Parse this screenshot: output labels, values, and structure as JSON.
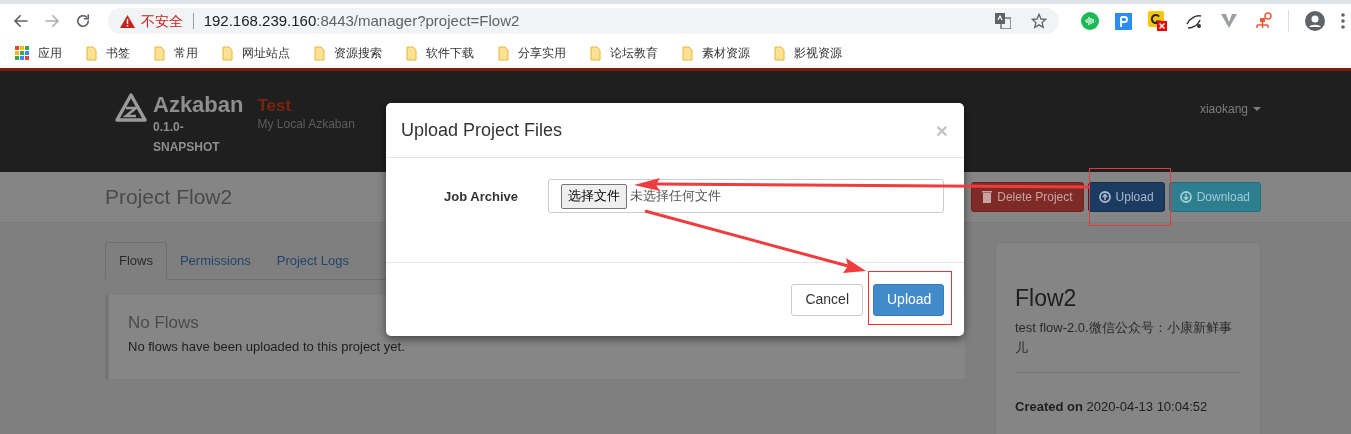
{
  "browser": {
    "nav_buttons": [
      {
        "kind": "back",
        "disabled": false
      },
      {
        "kind": "forward",
        "disabled": true
      },
      {
        "kind": "reload",
        "disabled": false
      }
    ],
    "security_label": "不安全",
    "url_host": "192.168.239.160",
    "url_rest": ":8443/manager?project=Flow2",
    "bookmarks": [
      {
        "label": "应用",
        "kind": "apps"
      },
      {
        "label": "书签",
        "kind": "folder"
      },
      {
        "label": "常用",
        "kind": "folder"
      },
      {
        "label": "网址站点",
        "kind": "folder"
      },
      {
        "label": "资源搜索",
        "kind": "folder"
      },
      {
        "label": "软件下载",
        "kind": "folder"
      },
      {
        "label": "分享实用",
        "kind": "folder"
      },
      {
        "label": "论坛教育",
        "kind": "folder"
      },
      {
        "label": "素材资源",
        "kind": "folder"
      },
      {
        "label": "影视资源",
        "kind": "folder"
      }
    ]
  },
  "navbar": {
    "brand": "Azkaban",
    "version": "0.1.0-SNAPSHOT",
    "env_name": "Test",
    "env_description": "My Local Azkaban",
    "user": "xiaokang"
  },
  "project": {
    "title": "Project Flow2",
    "actions": [
      {
        "label": "Delete Project",
        "kind": "delete"
      },
      {
        "label": "Upload",
        "kind": "upload"
      },
      {
        "label": "Download",
        "kind": "download"
      }
    ]
  },
  "tabs": [
    {
      "label": "Flows",
      "selected": true
    },
    {
      "label": "Permissions",
      "selected": false
    },
    {
      "label": "Project Logs",
      "selected": false
    }
  ],
  "notice": {
    "title": "No Flows",
    "message": "No flows have been uploaded to this project yet."
  },
  "flow_card": {
    "name": "Flow2",
    "description": "test flow-2.0.微信公众号：小康新鲜事儿",
    "created_label": "Created on",
    "created_value": "2020-04-13 10:04:52"
  },
  "dialog": {
    "title": "Upload Project Files",
    "close": "×",
    "field_label": "Job Archive",
    "choose_button": "选择文件",
    "file_status": "未选择任何文件",
    "buttons": [
      {
        "label": "Cancel",
        "kind": "default"
      },
      {
        "label": "Upload",
        "kind": "primary"
      }
    ]
  }
}
